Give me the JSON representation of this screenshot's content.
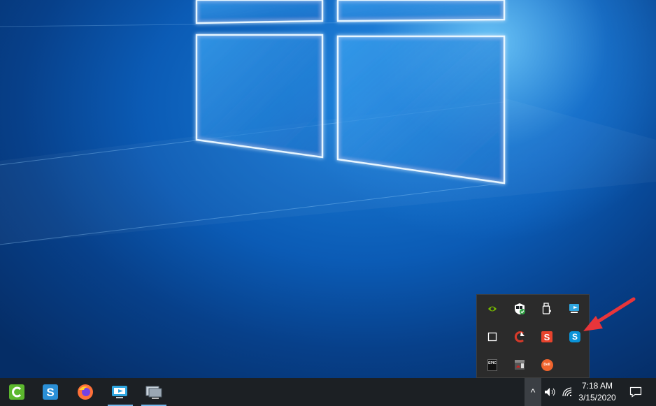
{
  "taskbar": {
    "apps": [
      {
        "name": "Camtasia",
        "icon": "camtasia-icon",
        "color": "#5cb82e"
      },
      {
        "name": "Snagit",
        "icon": "snagit-icon",
        "color": "#2a8fd6"
      },
      {
        "name": "Firefox",
        "icon": "firefox-icon",
        "color": "#ff7139"
      },
      {
        "name": "Remote Desktop",
        "icon": "remote-desktop-icon",
        "color": "#2fa6e0"
      },
      {
        "name": "Network monitor",
        "icon": "monitor-app-icon",
        "color": "#9aa7b4"
      }
    ],
    "clock": {
      "time": "7:18 AM",
      "date": "3/15/2020"
    },
    "tray_chevron": "^"
  },
  "flyout": {
    "items": [
      {
        "icon": "nvidia-icon",
        "color": "#76b900"
      },
      {
        "icon": "windows-security-icon",
        "color": "#2ea043"
      },
      {
        "icon": "usb-drive-icon",
        "color": "#ffffff"
      },
      {
        "icon": "remote-desktop-tray-icon",
        "color": "#2fa6e0"
      },
      {
        "icon": "blank-app-icon",
        "color": "#ffffff"
      },
      {
        "icon": "ccleaner-icon",
        "color": "#d73a2a"
      },
      {
        "icon": "snagit-tray-icon",
        "color": "#e8432d"
      },
      {
        "icon": "skype-icon",
        "color": "#0a93d8"
      },
      {
        "icon": "epic-games-icon",
        "color": "#ffffff"
      },
      {
        "icon": "sandboxie-icon",
        "color": "#c0c0c0"
      },
      {
        "icon": "dell-app-icon",
        "color": "#f0642d"
      }
    ],
    "text": {
      "epic": "EPIC",
      "snagit": "S",
      "skype": "S",
      "dell": "Dell"
    }
  },
  "annotation": {
    "arrow_color": "#e8353a"
  }
}
